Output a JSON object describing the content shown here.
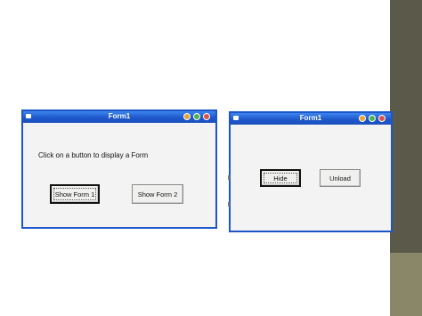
{
  "form1": {
    "title": "Form1",
    "instruction": "Click on a button to display a Form",
    "button1": "Show Form 1",
    "button2": "Show Form 2"
  },
  "form2": {
    "title": "Form1",
    "hide_button": "Hide",
    "unload_button": "Unload"
  },
  "colors": {
    "titlebar": "#1f58cc",
    "minimize": "#e5a33a",
    "maximize": "#4fb14a",
    "close": "#d9534a"
  }
}
